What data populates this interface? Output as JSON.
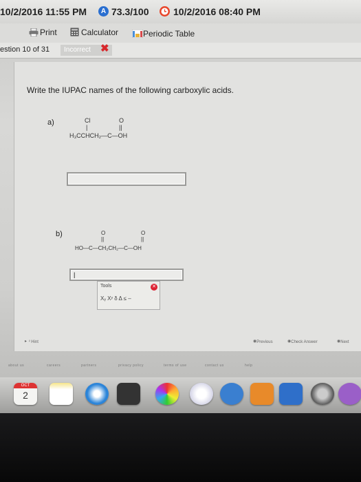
{
  "topbar": {
    "start_datetime": "10/2/2016 11:55 PM",
    "score_badge": "A",
    "score": "73.3/100",
    "end_datetime": "10/2/2016 08:40 PM"
  },
  "toolbar": {
    "print_label": "Print",
    "calculator_label": "Calculator",
    "periodic_table_label": "Periodic Table"
  },
  "question_bar": {
    "question_number": "estion 10 of 31",
    "status": "Incorrect"
  },
  "main": {
    "prompt": "Write the IUPAC names of the following carboxylic acids.",
    "part_a": {
      "label": "a)",
      "structure": {
        "cl": "Cl",
        "o": "O",
        "bond": "|",
        "double_bond": "||",
        "formula": "H₃CCHCH₂—C—OH"
      },
      "answer_value": ""
    },
    "part_b": {
      "label": "b)",
      "structure": {
        "o_left": "O",
        "o_right": "O",
        "double_bond": "||",
        "formula": "HO—C—CH₂CH₂—C—OH"
      },
      "answer_value": "|"
    },
    "tools": {
      "title": "Tools",
      "buttons": "Xᵧ  Xʸ  δ  Δ  ≤ –"
    }
  },
  "hint_bar": {
    "hint": "Hint",
    "previous": "Previous",
    "check_answer": "Check Answer",
    "next": "Next"
  },
  "footer_links": [
    "about us",
    "careers",
    "partners",
    "privacy policy",
    "terms of use",
    "contact us",
    "help"
  ],
  "dock": {
    "calendar_month": "OCT",
    "calendar_day": "2"
  },
  "colors": {
    "incorrect_x": "#d8282c",
    "score_badge": "#2a6fd0",
    "end_badge": "#e8462b"
  }
}
